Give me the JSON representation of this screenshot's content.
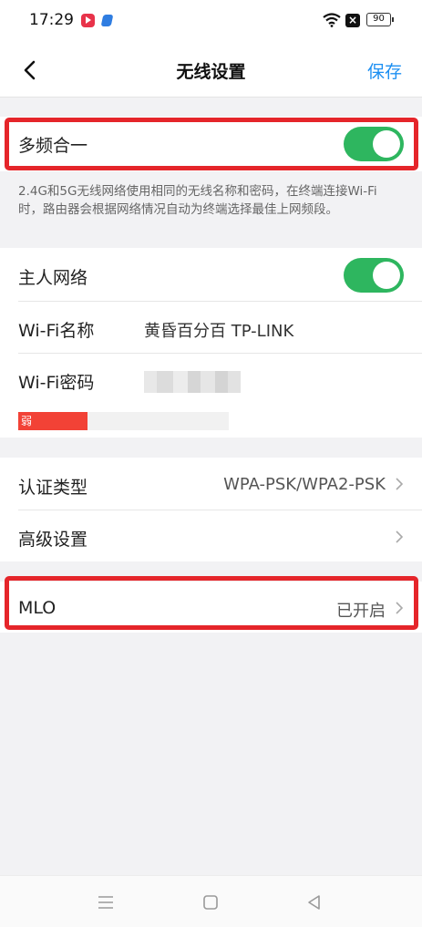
{
  "status_bar": {
    "time": "17:29",
    "battery": "90"
  },
  "nav": {
    "title": "无线设置",
    "save_label": "保存"
  },
  "multi_band": {
    "label": "多频合一",
    "enabled": true
  },
  "description": "2.4G和5G无线网络使用相同的无线名称和密码，在终端连接Wi-Fi时，路由器会根据网络情况自动为终端选择最佳上网频段。",
  "main_network": {
    "label": "主人网络",
    "enabled": true
  },
  "wifi_name": {
    "label": "Wi-Fi名称",
    "value": "黄昏百分百 TP-LINK"
  },
  "wifi_password": {
    "label": "Wi-Fi密码",
    "strength_label": "弱",
    "strength_fraction": 0.33
  },
  "auth_type": {
    "label": "认证类型",
    "value": "WPA-PSK/WPA2-PSK"
  },
  "advanced": {
    "label": "高级设置"
  },
  "mlo": {
    "label": "MLO",
    "value": "已开启"
  },
  "colors": {
    "accent": "#1c8ff2",
    "toggle_on": "#2eb65f",
    "highlight": "#e5252a",
    "strength_weak": "#f24236"
  },
  "icons": [
    "play-app-icon",
    "blue-app-icon",
    "wifi-icon",
    "close-box-icon",
    "battery-icon",
    "back-arrow-icon",
    "chevron-right-icon",
    "menu-icon",
    "home-square-icon",
    "back-triangle-icon"
  ]
}
